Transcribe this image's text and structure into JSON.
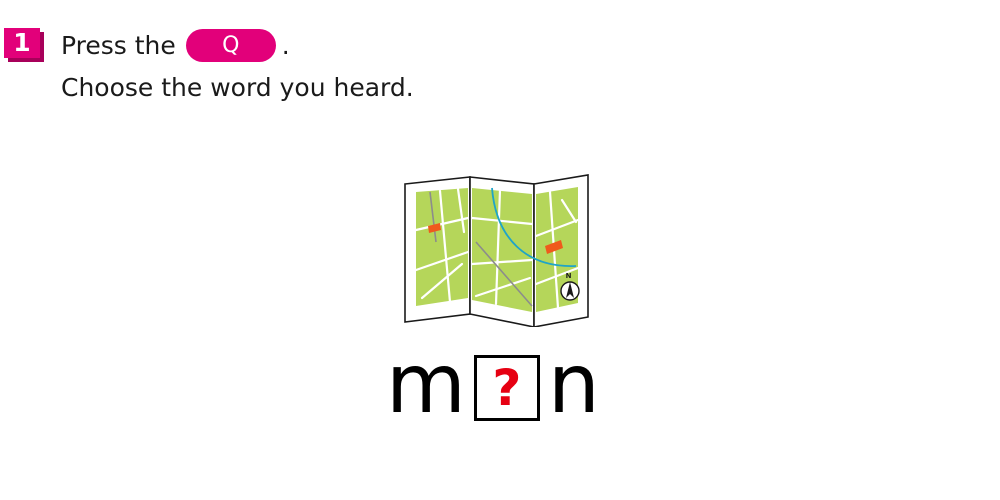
{
  "instruction": {
    "step_number": "1",
    "line1_before": "Press the",
    "button_label": "Q",
    "line1_after": ".",
    "line2": "Choose the word you heard."
  },
  "illustration": {
    "icon": "map-icon",
    "compass_label": "N"
  },
  "word": {
    "first_letter": "m",
    "missing_symbol": "?",
    "last_letter": "n"
  },
  "colors": {
    "accent": "#e2007a",
    "question_mark": "#e60012",
    "map_green": "#b5d65a",
    "map_marker": "#ef5a1c",
    "map_river": "#1fa4c8"
  }
}
